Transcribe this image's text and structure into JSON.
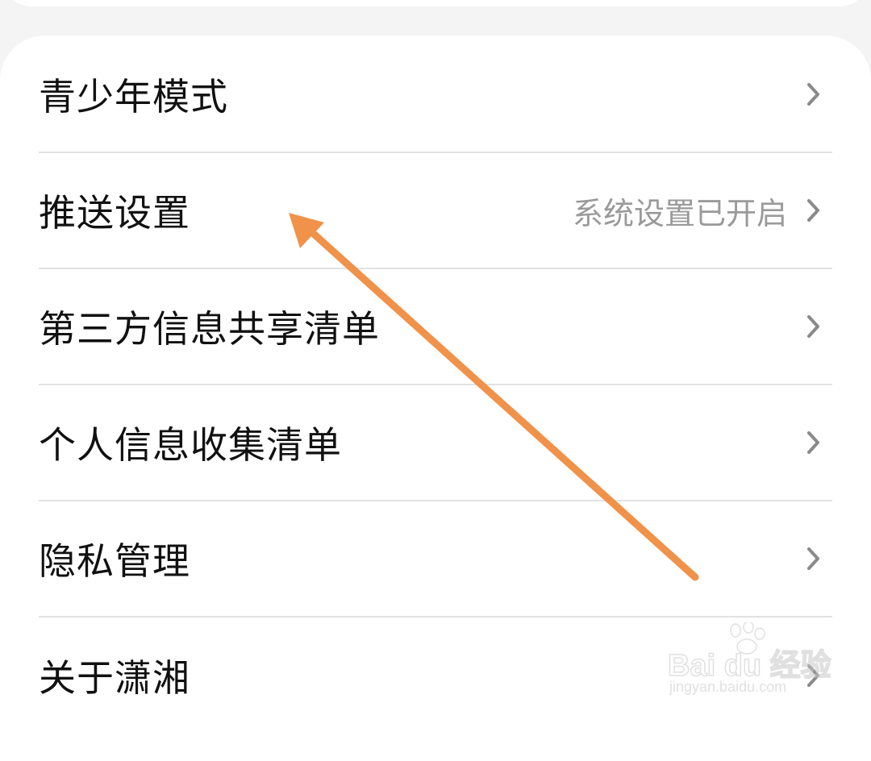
{
  "settings": {
    "items": [
      {
        "label": "青少年模式",
        "value": ""
      },
      {
        "label": "推送设置",
        "value": "系统设置已开启"
      },
      {
        "label": "第三方信息共享清单",
        "value": ""
      },
      {
        "label": "个人信息收集清单",
        "value": ""
      },
      {
        "label": "隐私管理",
        "value": ""
      },
      {
        "label": "关于潇湘",
        "value": ""
      }
    ],
    "chevron_icon": "chevron-right-icon"
  },
  "annotation": {
    "arrow_color": "#f0924a",
    "arrow_icon": "arrow-icon"
  },
  "watermark": {
    "logo_text": "Bai du 经验",
    "url": "jingyan.baidu.com"
  },
  "colors": {
    "background": "#f4f4f4",
    "card": "#ffffff",
    "divider": "#e2e2e2",
    "label_text": "#111111",
    "value_text": "#9a9a9a",
    "chevron": "#8a8a8a"
  }
}
